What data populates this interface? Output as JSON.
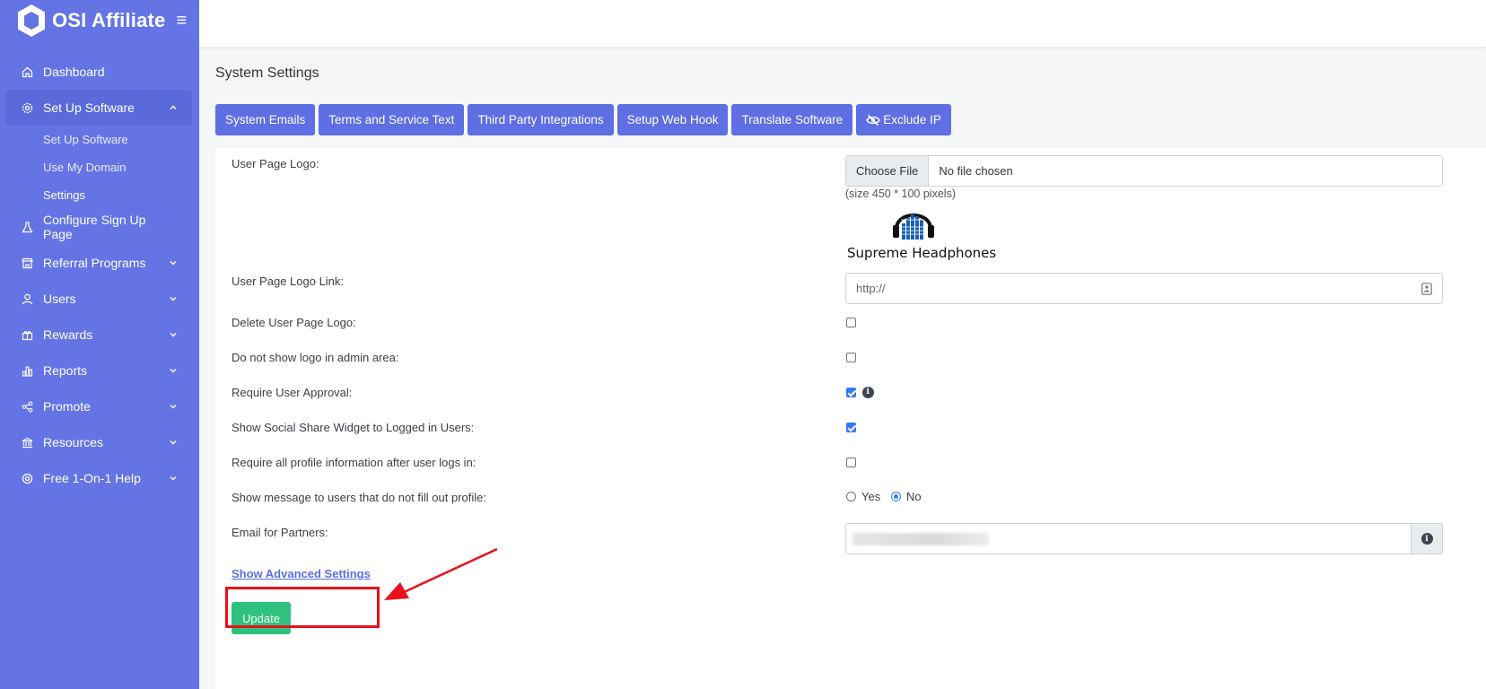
{
  "brand": {
    "name": "OSI Affiliate",
    "hamburger": "≡"
  },
  "sidebar": {
    "items": [
      {
        "label": "Dashboard",
        "icon": "home-icon"
      },
      {
        "label": "Set Up Software",
        "icon": "gear-icon",
        "expanded": true
      },
      {
        "label": "Configure Sign Up Page",
        "icon": "flask-icon"
      },
      {
        "label": "Referral Programs",
        "icon": "store-icon"
      },
      {
        "label": "Users",
        "icon": "user-icon"
      },
      {
        "label": "Rewards",
        "icon": "gift-icon"
      },
      {
        "label": "Reports",
        "icon": "bar-chart-icon"
      },
      {
        "label": "Promote",
        "icon": "share-icon"
      },
      {
        "label": "Resources",
        "icon": "bank-icon"
      },
      {
        "label": "Free 1-On-1 Help",
        "icon": "lifebuoy-icon"
      }
    ],
    "subitems": [
      {
        "label": "Set Up Software"
      },
      {
        "label": "Use My Domain"
      },
      {
        "label": "Settings"
      }
    ]
  },
  "page": {
    "title": "System Settings"
  },
  "tabs": [
    {
      "label": "System Emails"
    },
    {
      "label": "Terms and Service Text"
    },
    {
      "label": "Third Party Integrations"
    },
    {
      "label": "Setup Web Hook"
    },
    {
      "label": "Translate Software"
    },
    {
      "label": "Exclude IP"
    }
  ],
  "form": {
    "logo": {
      "label": "User Page Logo:",
      "choose_file": "Choose File",
      "no_file": "No file chosen",
      "size_hint": "(size 450 * 100 pixels)",
      "logo_text": "Supreme Headphones"
    },
    "logo_link": {
      "label": "User Page Logo Link:",
      "value": "http://"
    },
    "delete_logo": {
      "label": "Delete User Page Logo:",
      "checked": false
    },
    "hide_logo_admin": {
      "label": "Do not show logo in admin area:",
      "checked": false
    },
    "require_approval": {
      "label": "Require User Approval:",
      "checked": true
    },
    "social_share": {
      "label": "Show Social Share Widget to Logged in Users:",
      "checked": true
    },
    "require_profile": {
      "label": "Require all profile information after user logs in:",
      "checked": false
    },
    "show_message": {
      "label": "Show message to users that do not fill out profile:",
      "yes": "Yes",
      "no": "No",
      "selected": "No"
    },
    "email_partners": {
      "label": "Email for Partners:"
    },
    "advanced_link": "Show Advanced Settings",
    "update_button": "Update"
  },
  "colors": {
    "sidebar": "#6474e5",
    "tab": "#5e6ee3",
    "update": "#2ec27e",
    "highlight": "#e8101b"
  }
}
